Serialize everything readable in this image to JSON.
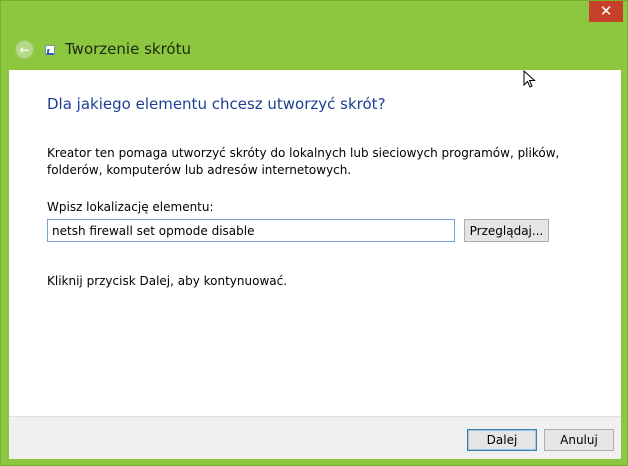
{
  "window": {
    "title": "Tworzenie skrótu",
    "close_glyph": "✕",
    "back_glyph": "←"
  },
  "main": {
    "heading": "Dla jakiego elementu chcesz utworzyć skrót?",
    "description": "Kreator ten pomaga utworzyć skróty do lokalnych lub sieciowych programów, plików, folderów, komputerów lub adresów internetowych.",
    "location_label": "Wpisz lokalizację elementu:",
    "location_value": "netsh firewall set opmode disable",
    "browse_label": "Przeglądaj...",
    "hint": "Kliknij przycisk Dalej, aby kontynuować."
  },
  "footer": {
    "next_label": "Dalej",
    "cancel_label": "Anuluj"
  },
  "colors": {
    "frame": "#8dc63f",
    "heading": "#1c3f94",
    "close": "#c7402a"
  },
  "icons": {
    "back": "back-arrow-icon",
    "shortcut": "shortcut-icon",
    "close": "close-icon",
    "cursor": "mouse-cursor-icon"
  }
}
